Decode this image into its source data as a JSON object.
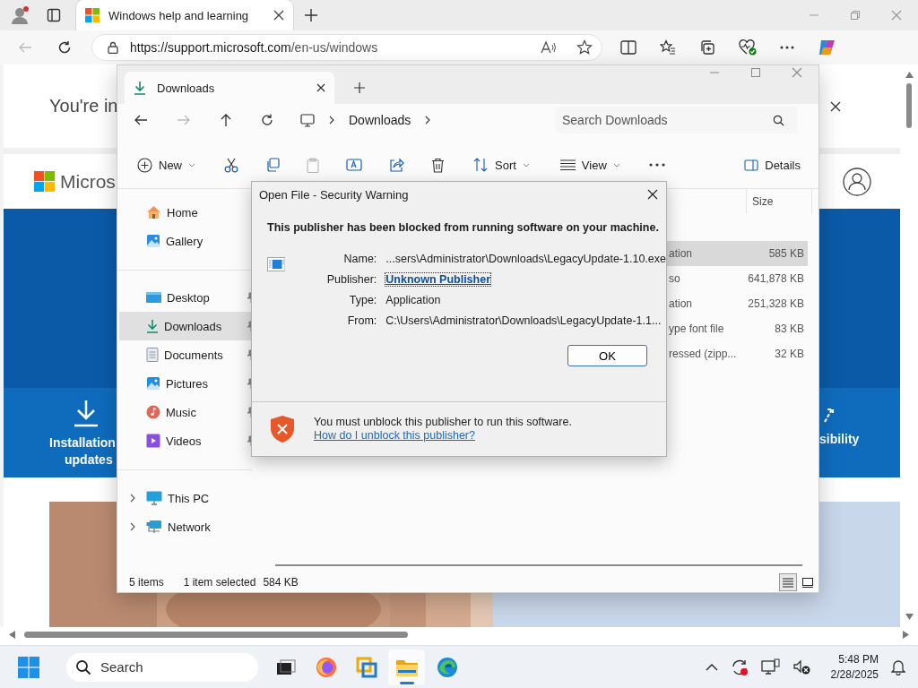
{
  "browser": {
    "tabs": [
      {
        "title": "Windows help and learning",
        "selected": true
      }
    ],
    "address": {
      "host": "https://support.microsoft.com",
      "path": "/en-us/windows"
    }
  },
  "web_page": {
    "notice": "You're in",
    "logo_text": "Micros",
    "tiles": [
      {
        "kind": "download",
        "lines": [
          "Installation",
          "updates"
        ]
      },
      {
        "kind": "accessibility",
        "lines": [
          "sibility"
        ]
      }
    ]
  },
  "explorer": {
    "tabs": [
      {
        "title": "Downloads",
        "selected": true
      }
    ],
    "breadcrumb": "Downloads",
    "search": {
      "placeholder": "Search Downloads"
    },
    "toolbar": [
      {
        "kind": "new",
        "label": "New"
      },
      {
        "kind": "cut"
      },
      {
        "kind": "copy"
      },
      {
        "kind": "paste",
        "disabled": true
      },
      {
        "kind": "rename"
      },
      {
        "kind": "share"
      },
      {
        "kind": "delete"
      },
      {
        "kind": "sort",
        "label": "Sort"
      },
      {
        "kind": "view",
        "label": "View"
      },
      {
        "kind": "more"
      }
    ],
    "details_button": "Details",
    "nav_sections": [
      {
        "items": [
          {
            "kind": "home",
            "label": "Home",
            "selected": false,
            "pinned": false
          },
          {
            "kind": "gallery",
            "label": "Gallery",
            "selected": false,
            "pinned": false
          }
        ]
      },
      {
        "items": [
          {
            "kind": "desktop",
            "label": "Desktop",
            "selected": false,
            "pinned": true
          },
          {
            "kind": "downloads",
            "label": "Downloads",
            "selected": true,
            "pinned": true
          },
          {
            "kind": "documents",
            "label": "Documents",
            "selected": false,
            "pinned": true
          },
          {
            "kind": "pictures",
            "label": "Pictures",
            "selected": false,
            "pinned": true
          },
          {
            "kind": "music",
            "label": "Music",
            "selected": false,
            "pinned": true
          },
          {
            "kind": "videos",
            "label": "Videos",
            "selected": false,
            "pinned": true
          }
        ]
      },
      {
        "items": [
          {
            "kind": "pc",
            "label": "This PC",
            "selected": false,
            "expanded": false
          },
          {
            "kind": "network",
            "label": "Network",
            "selected": false,
            "expanded": false
          }
        ]
      }
    ],
    "size_column": "Size",
    "files": [
      {
        "type": "ation",
        "size": "585 KB",
        "selected": true
      },
      {
        "type": "so",
        "size": "641,878 KB",
        "selected": false
      },
      {
        "type": "ation",
        "size": "251,328 KB",
        "selected": false
      },
      {
        "type": "ype font file",
        "size": "83 KB",
        "selected": false
      },
      {
        "type": "ressed (zipp...",
        "size": "32 KB",
        "selected": false
      }
    ],
    "status": {
      "count": "5 items",
      "selection": "1 item selected",
      "selection_size": "584 KB"
    },
    "view_modes": [
      {
        "kind": "details",
        "selected": true
      },
      {
        "kind": "tiles",
        "selected": false
      }
    ]
  },
  "dialog": {
    "title": "Open File - Security Warning",
    "heading": "This publisher has been blocked from running software on your machine.",
    "fields": [
      {
        "label": "Name:",
        "value": "...sers\\Administrator\\Downloads\\LegacyUpdate-1.10.exe",
        "kind": "text"
      },
      {
        "label": "Publisher:",
        "value": "Unknown Publisher",
        "kind": "link"
      },
      {
        "label": "Type:",
        "value": "Application",
        "kind": "text"
      },
      {
        "label": "From:",
        "value": "C:\\Users\\Administrator\\Downloads\\LegacyUpdate-1.1...",
        "kind": "text"
      }
    ],
    "ok_button": "OK",
    "footer_text": "You must unblock this publisher to run this software.",
    "footer_link": "How do I unblock this publisher?"
  },
  "taskbar": {
    "search": {
      "placeholder": "Search"
    },
    "apps": [
      {
        "kind": "taskview",
        "active": false
      },
      {
        "kind": "firefox",
        "active": false
      },
      {
        "kind": "remote",
        "active": false
      },
      {
        "kind": "explorer",
        "active": true
      },
      {
        "kind": "edge",
        "active": false
      }
    ],
    "time": "5:48 PM",
    "date": "2/28/2025"
  }
}
